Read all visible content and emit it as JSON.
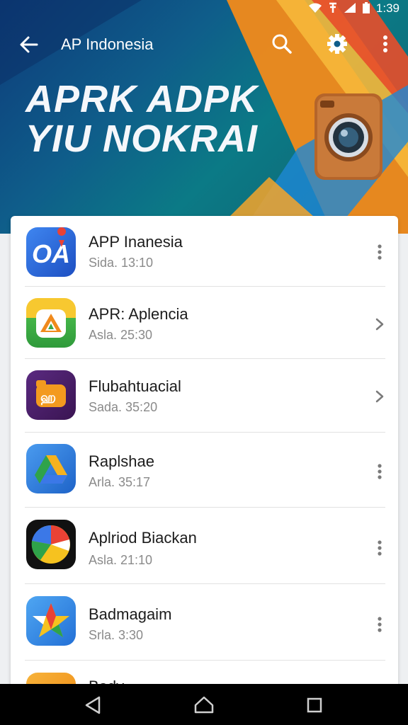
{
  "status_bar": {
    "time": "1:39",
    "icons": [
      "wifi-icon",
      "signal-icon",
      "signal-bars-icon",
      "battery-icon"
    ]
  },
  "app_bar": {
    "title": "AP Indonesia",
    "back_icon": "arrow-left-icon",
    "search_icon": "search-icon",
    "settings_icon": "gear-icon",
    "more_icon": "more-vertical-icon"
  },
  "hero": {
    "line1": "APRK ADPK",
    "line2": "YIU NOKRAI",
    "image": "camera-icon"
  },
  "apps": [
    {
      "name": "APP Inanesia",
      "subtitle": "Sida. 13:10",
      "action": "more-vertical-icon",
      "icon": "oa-app-icon",
      "icon_color": "#2f6fe0"
    },
    {
      "name": "APR: Aplencia",
      "subtitle": "Asla. 25:30",
      "action": "chevron-right-icon",
      "icon": "triangle-app-icon",
      "icon_color": "#44b548"
    },
    {
      "name": "Flubahtuacial",
      "subtitle": "Sada. 35:20",
      "action": "chevron-right-icon",
      "icon": "flag-app-icon",
      "icon_color": "#4a1d6a"
    },
    {
      "name": "Raplshae",
      "subtitle": "Arla. 35:17",
      "action": "more-vertical-icon",
      "icon": "drive-app-icon",
      "icon_color": "#2c7be5"
    },
    {
      "name": "Aplriod Biackan",
      "subtitle": "Asla. 21:10",
      "action": "more-vertical-icon",
      "icon": "pie-app-icon",
      "icon_color": "#111111"
    },
    {
      "name": "Badmagaim",
      "subtitle": "Srla. 3:30",
      "action": "more-vertical-icon",
      "icon": "star-app-icon",
      "icon_color": "#3a8fe3"
    },
    {
      "name": "Badv",
      "subtitle": "",
      "action": "",
      "icon": "orange-app-icon",
      "icon_color": "#f39a1f"
    }
  ],
  "nav_bar": {
    "back": "nav-back-icon",
    "home": "nav-home-icon",
    "recents": "nav-recents-icon"
  }
}
